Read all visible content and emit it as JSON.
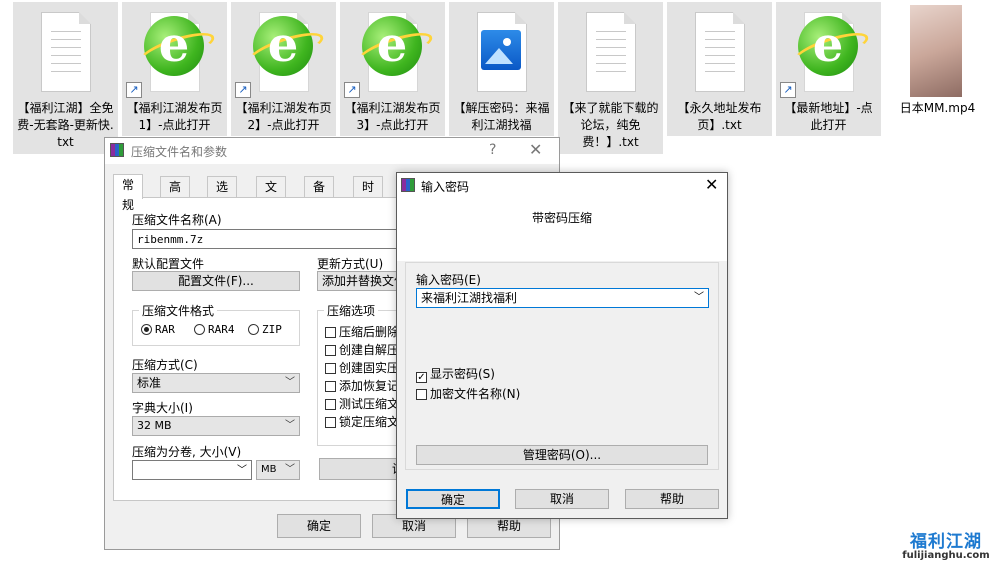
{
  "files": [
    {
      "name": "【福利江湖】全免费-无套路-更新快.txt",
      "kind": "txt"
    },
    {
      "name": "【福利江湖发布页1】-点此打开",
      "kind": "link"
    },
    {
      "name": "【福利江湖发布页2】-点此打开",
      "kind": "link"
    },
    {
      "name": "【福利江湖发布页3】-点此打开",
      "kind": "link"
    },
    {
      "name": "【解压密码：来福利江湖找福",
      "kind": "image"
    },
    {
      "name": "【来了就能下载的论坛，纯免费！】.txt",
      "kind": "txt"
    },
    {
      "name": "【永久地址发布页】.txt",
      "kind": "txt"
    },
    {
      "name": "【最新地址】-点此打开",
      "kind": "link"
    },
    {
      "name": "日本MM.mp4",
      "kind": "video"
    }
  ],
  "archive_dialog": {
    "title": "压缩文件名和参数",
    "help": "?",
    "close": "✕",
    "tabs": [
      "常规",
      "高级",
      "选项",
      "文件",
      "备份",
      "时间"
    ],
    "archive_name_label": "压缩文件名称(A)",
    "archive_name_value": "ribenmm.7z",
    "default_profile_label": "默认配置文件",
    "profile_button": "配置文件(F)...",
    "update_mode_label": "更新方式(U)",
    "update_mode_value": "添加并替换文件",
    "format_group": "压缩文件格式",
    "formats": [
      "RAR",
      "RAR4",
      "ZIP"
    ],
    "format_selected": "RAR",
    "method_label": "压缩方式(C)",
    "method_value": "标准",
    "dict_label": "字典大小(I)",
    "dict_value": "32 MB",
    "split_label": "压缩为分卷, 大小(V)",
    "split_value": "",
    "split_unit": "MB",
    "options_group": "压缩选项",
    "options": [
      "压缩后删除",
      "创建自解压",
      "创建固实压",
      "添加恢复记",
      "测试压缩文",
      "锁定压缩文"
    ],
    "set_button": "设",
    "ok": "确定",
    "cancel": "取消",
    "help_btn": "帮助"
  },
  "password_dialog": {
    "title": "输入密码",
    "close": "✕",
    "header": "带密码压缩",
    "password_label": "输入密码(E)",
    "password_value": "来福利江湖找福利",
    "show_password": "显示密码(S)",
    "show_password_checked": true,
    "encrypt_names": "加密文件名称(N)",
    "encrypt_names_checked": false,
    "manage_button": "管理密码(O)...",
    "ok": "确定",
    "cancel": "取消",
    "help": "帮助"
  },
  "watermark": {
    "title": "福利江湖",
    "domain": "fulijianghu.com"
  },
  "colors": {
    "focus": "#0078d7",
    "selection": "#e3e3e3"
  }
}
